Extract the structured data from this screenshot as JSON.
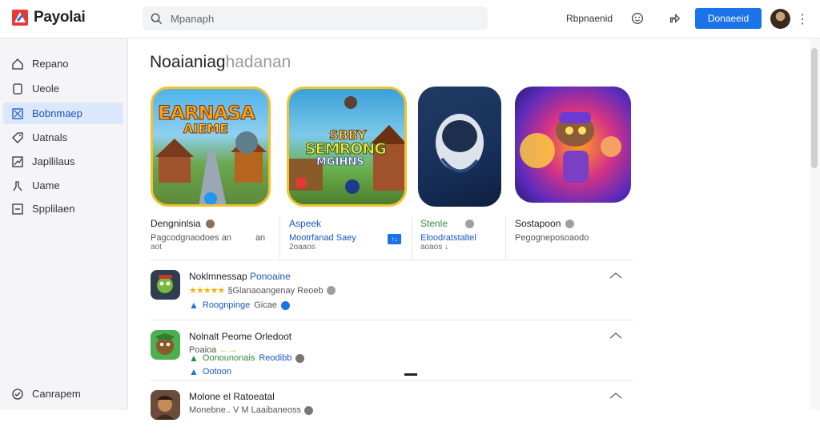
{
  "app": {
    "name": "Payolai",
    "brand_color": "#e53935"
  },
  "search": {
    "placeholder": "Mpanaph"
  },
  "header": {
    "link_label": "Rbpnaenid",
    "primary_button": "Donaeeid",
    "more": "⋮",
    "icons": [
      "smiley-icon",
      "share-icon"
    ]
  },
  "sidebar": {
    "items": [
      {
        "label": "Repano",
        "icon": "home-icon"
      },
      {
        "label": "Ueole",
        "icon": "bookmark-icon"
      },
      {
        "label": "Bobnmaep",
        "icon": "apps-icon",
        "active": true
      },
      {
        "label": "Uatnals",
        "icon": "tag-icon"
      },
      {
        "label": "Japllilaus",
        "icon": "chart-icon"
      },
      {
        "label": "Uame",
        "icon": "person-icon"
      },
      {
        "label": "Spplilaen",
        "icon": "list-icon"
      }
    ],
    "footer": {
      "label": "Canrapem",
      "icon": "check-circle-icon"
    }
  },
  "section": {
    "title_main": "Noaianiag",
    "title_light": "hadanan"
  },
  "featured": [
    {
      "art_text_1": "EARNASA",
      "art_text_2": "AIEME",
      "name": "Dengninlsia",
      "name_color": "#202124",
      "sub": "Pagcodgnaodoes an",
      "sub2": "aot",
      "extra": "an"
    },
    {
      "art_text_1": "SBBY",
      "art_text_2": "SEMRONG",
      "art_text_3": "MGIHNS",
      "name": "Aspeek",
      "name_color": "#1a56c4",
      "sub": "Mootrfanad Saey",
      "sub2": "2oaaos",
      "badge": "↑↓"
    },
    {
      "name": "Stenle",
      "name_color": "#2e8b3d",
      "sub": "Eloodratstaltel",
      "sub2": "aoaos ↓"
    },
    {
      "name": "Sostapoon",
      "name_color": "#202124",
      "sub": "Pegogneposoaodo",
      "sub2": ""
    }
  ],
  "list": [
    {
      "title": "Noklmnessap",
      "title_accent": "Ponoaine",
      "rating_stars": "★★★★★",
      "meta": "§Glanaoangenay Reoeb",
      "line3_link": "Roognpinge",
      "line3_extra": "Gicae",
      "icon_colors": [
        "#2f3d4f",
        "#7ab83c"
      ]
    },
    {
      "title": "Nolnalt Peome",
      "title_accent": "Orledoot",
      "meta": "Poaioa",
      "meta_accent": "←→",
      "line3_link": "Oonounonais",
      "line3_link2": "Reodibb",
      "line3_extra": "Ootoon",
      "icon_colors": [
        "#8a5a2b",
        "#4caf50"
      ]
    },
    {
      "title": "Molone el",
      "title_accent": "Ratoeatal",
      "meta": "Monebne.. V M Laaibaneoss",
      "icon_colors": [
        "#6b4b3a",
        "#c48a5a"
      ]
    }
  ]
}
